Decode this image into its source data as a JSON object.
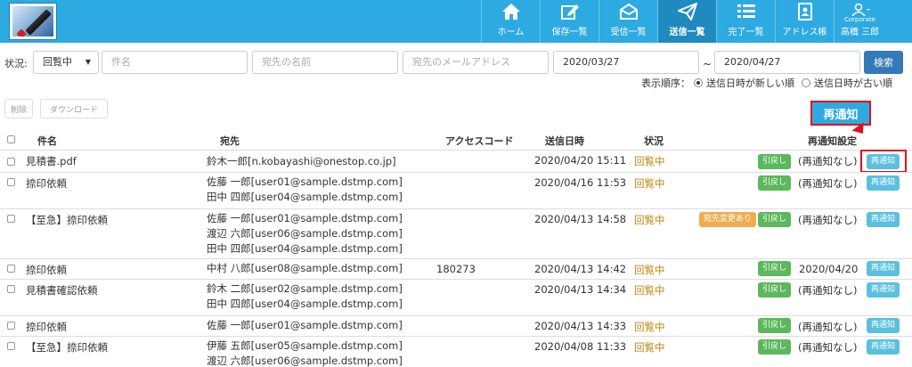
{
  "nav": {
    "items": [
      {
        "label": "ホーム",
        "icon": "home-icon"
      },
      {
        "label": "保存一覧",
        "icon": "edit-icon"
      },
      {
        "label": "受信一覧",
        "icon": "inbox-icon"
      },
      {
        "label": "送信一覧",
        "icon": "paper-plane-icon",
        "active": true
      },
      {
        "label": "完了一覧",
        "icon": "list-icon"
      },
      {
        "label": "アドレス帳",
        "icon": "address-book-icon"
      }
    ],
    "user": {
      "corp": "Corporate",
      "name": "高橋 三郎"
    }
  },
  "filters": {
    "status_label": "状況:",
    "status_value": "回覧中",
    "subject_placeholder": "件名",
    "recipient_name_placeholder": "宛先の名前",
    "recipient_email_placeholder": "宛先のメールアドレス",
    "date_from": "2020/03/27",
    "range_sep": "~",
    "date_to": "2020/04/27",
    "search_label": "検索"
  },
  "sort": {
    "label": "表示順序：",
    "newest": "送信日時が新しい順",
    "oldest": "送信日時が古い順"
  },
  "actions": {
    "delete": "削除",
    "download": "ダウンロード"
  },
  "callout": "再通知",
  "table": {
    "headers": {
      "subject": "件名",
      "recipient": "宛先",
      "access_code": "アクセスコード",
      "sent_at": "送信日時",
      "status": "状況",
      "renotify": "再通知設定"
    },
    "rows": [
      {
        "subject": "見積書.pdf",
        "recipients": [
          "鈴木一郎[n.kobayashi@onestop.co.jp]"
        ],
        "code": "",
        "sent": "2020/04/20 15:11",
        "status": "回覧中",
        "changed": "",
        "recall": "引戻し",
        "renotify": "(再通知なし)",
        "btn": "再通知"
      },
      {
        "subject": "捺印依頼",
        "recipients": [
          "佐藤 一郎[user01@sample.dstmp.com]",
          "田中 四郎[user04@sample.dstmp.com]"
        ],
        "code": "",
        "sent": "2020/04/16 11:53",
        "status": "回覧中",
        "changed": "",
        "recall": "引戻し",
        "renotify": "(再通知なし)",
        "btn": "再通知"
      },
      {
        "subject": "【至急】捺印依頼",
        "recipients": [
          "佐藤 一郎[user01@sample.dstmp.com]",
          "渡辺 六郎[user06@sample.dstmp.com]",
          "田中 四郎[user04@sample.dstmp.com]"
        ],
        "code": "",
        "sent": "2020/04/13 14:58",
        "status": "回覧中",
        "changed": "宛先変更あり",
        "recall": "引戻し",
        "renotify": "(再通知なし)",
        "btn": "再通知"
      },
      {
        "subject": "捺印依頼",
        "recipients": [
          "中村 八郎[user08@sample.dstmp.com]"
        ],
        "code": "180273",
        "sent": "2020/04/13 14:42",
        "status": "回覧中",
        "changed": "",
        "recall": "引戻し",
        "renotify": "2020/04/20",
        "btn": "再通知"
      },
      {
        "subject": "見積書確認依頼",
        "recipients": [
          "鈴木 二郎[user02@sample.dstmp.com]",
          "田中 四郎[user04@sample.dstmp.com]"
        ],
        "code": "",
        "sent": "2020/04/13 14:34",
        "status": "回覧中",
        "changed": "",
        "recall": "引戻し",
        "renotify": "(再通知なし)",
        "btn": "再通知"
      },
      {
        "subject": "捺印依頼",
        "recipients": [
          "佐藤 一郎[user01@sample.dstmp.com]"
        ],
        "code": "",
        "sent": "2020/04/13 14:33",
        "status": "回覧中",
        "changed": "",
        "recall": "引戻し",
        "renotify": "(再通知なし)",
        "btn": "再通知"
      },
      {
        "subject": "【至急】捺印依頼",
        "recipients": [
          "伊藤 五郎[user05@sample.dstmp.com]",
          "渡辺 六郎[user06@sample.dstmp.com]"
        ],
        "code": "",
        "sent": "2020/04/08 11:33",
        "status": "回覧中",
        "changed": "",
        "recall": "引戻し",
        "renotify": "(再通知なし)",
        "btn": "再通知"
      }
    ]
  },
  "colors": {
    "nav_bg": "#2daae1",
    "nav_active": "#1f8ac0",
    "recall": "#5cb85c",
    "renotify": "#5bc0de",
    "changed": "#f0ad4e",
    "status": "#c0840a",
    "highlight": "#e0101c"
  }
}
